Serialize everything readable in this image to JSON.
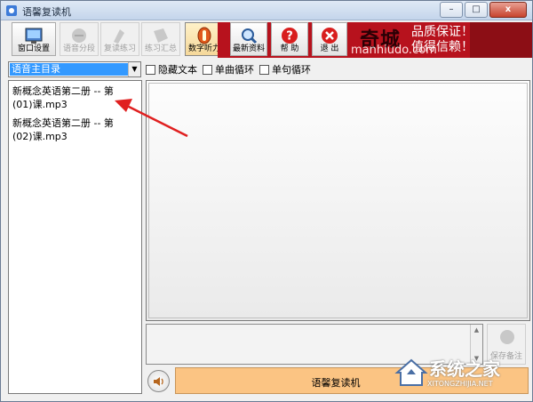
{
  "window": {
    "title": "语馨复读机",
    "controls": {
      "minimize": "–",
      "maximize": "□",
      "close": "x"
    }
  },
  "toolbar": {
    "items": [
      {
        "label": "窗口设置",
        "icon": "window-settings-icon",
        "enabled": true
      },
      {
        "label": "语音分段",
        "icon": "voice-segment-icon",
        "enabled": false
      },
      {
        "label": "复读练习",
        "icon": "repeat-practice-icon",
        "enabled": false
      },
      {
        "label": "练习汇总",
        "icon": "practice-summary-icon",
        "enabled": false
      },
      {
        "label": "数字听力",
        "icon": "digital-listening-icon",
        "enabled": true,
        "active": true
      },
      {
        "label": "最新资料",
        "icon": "latest-materials-icon",
        "enabled": true
      },
      {
        "label": "帮 助",
        "icon": "help-icon",
        "enabled": true
      },
      {
        "label": "退 出",
        "icon": "exit-icon",
        "enabled": true
      }
    ]
  },
  "banner": {
    "line1": "品质保证！",
    "line2": "值得信赖！",
    "ghost_text": "奇城",
    "ghost_url": "manhiudo.com",
    "color": "#b7121d"
  },
  "playlist": {
    "selected": "语音主目录"
  },
  "options": [
    {
      "label": "隐藏文本",
      "checked": false
    },
    {
      "label": "单曲循环",
      "checked": false
    },
    {
      "label": "单句循环",
      "checked": false
    }
  ],
  "files": [
    {
      "line1": "新概念英语第二册 -- 第",
      "line2": "(01)课.mp3"
    },
    {
      "line1": "新概念英语第二册 -- 第",
      "line2": "(02)课.mp3"
    }
  ],
  "save_notes": {
    "label": "保存备注",
    "enabled": false
  },
  "status": {
    "text": "语馨复读机",
    "color": "#fbc483"
  },
  "watermark": {
    "cn": "系统之家",
    "en": "XITONGZHIJIA.NET"
  }
}
